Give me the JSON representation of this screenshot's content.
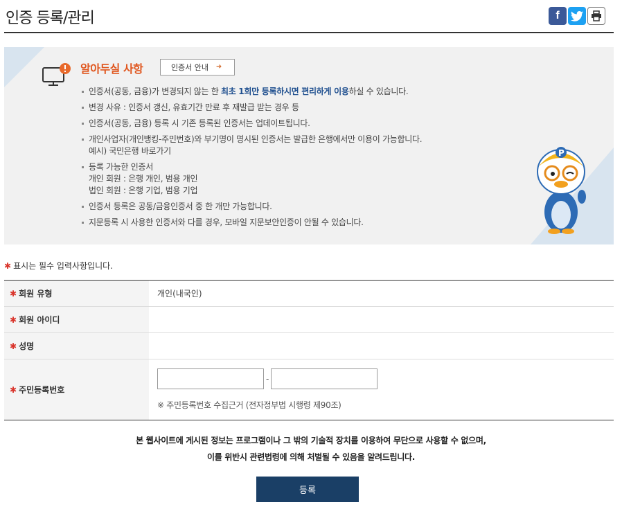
{
  "page": {
    "title": "인증 등록/관리"
  },
  "share": {
    "facebook_icon": "f",
    "twitter_icon": "t",
    "print_icon": "⎙"
  },
  "notice": {
    "heading": "알아두실 사항",
    "guide_button": "인증서 안내",
    "guide_arrow": "➜",
    "items": [
      {
        "pre": "인증서(공동, 금융)가 변경되지 않는 한 ",
        "highlight": "최초 1회만 등록하시면 편리하게 이용",
        "post": "하실 수 있습니다."
      },
      {
        "text": "변경 사유 : 인증서 갱신, 유효기간 만료 후 재발급 받는 경우 등"
      },
      {
        "text": "인증서(공동, 금융) 등록 시 기존 등록된 인증서는 업데이트됩니다."
      },
      {
        "text": "개인사업자(개인뱅킹-주민번호)와 부기명이 명시된 인증서는 발급한 은행에서만 이용이 가능합니다.",
        "sub": [
          "예시) 국민은행 바로가기"
        ]
      },
      {
        "text": "등록 가능한 인증서",
        "sub": [
          "개인 회원 : 은행 개인, 범용 개인",
          "법인 회원 : 은행 기업, 범용 기업"
        ]
      },
      {
        "text": "인증서 등록은 공동/금융인증서 중 한 개만 가능합니다."
      },
      {
        "text": "지문등록 시 사용한 인증서와 다를 경우, 모바일 지문보안인증이 안될 수 있습니다."
      }
    ]
  },
  "form": {
    "required_marker": "✱",
    "required_note": "표시는 필수 입력사항입니다.",
    "rows": {
      "member_type_label": "회원 유형",
      "member_type_value": "개인(내국인)",
      "member_id_label": "회원 아이디",
      "name_label": "성명",
      "ssn_label": "주민등록번호",
      "ssn_dash": "-",
      "ssn_note": "※ 주민등록번호 수집근거 (전자정부법 시행령 제90조)"
    }
  },
  "legal": {
    "line1": "본 웹사이트에 게시된 정보는 프로그램이나 그 밖의 기술적 장치를 이용하여 무단으로 사용할 수 없으며,",
    "line2": "이를 위반시 관련법령에 의해 처벌될 수 있음을 알려드립니다."
  },
  "submit": {
    "label": "등록"
  },
  "colors": {
    "accent_orange": "#e0561e",
    "highlight_blue": "#1f4f8f",
    "button_navy": "#1a3f66",
    "required_red": "#d9342b"
  }
}
